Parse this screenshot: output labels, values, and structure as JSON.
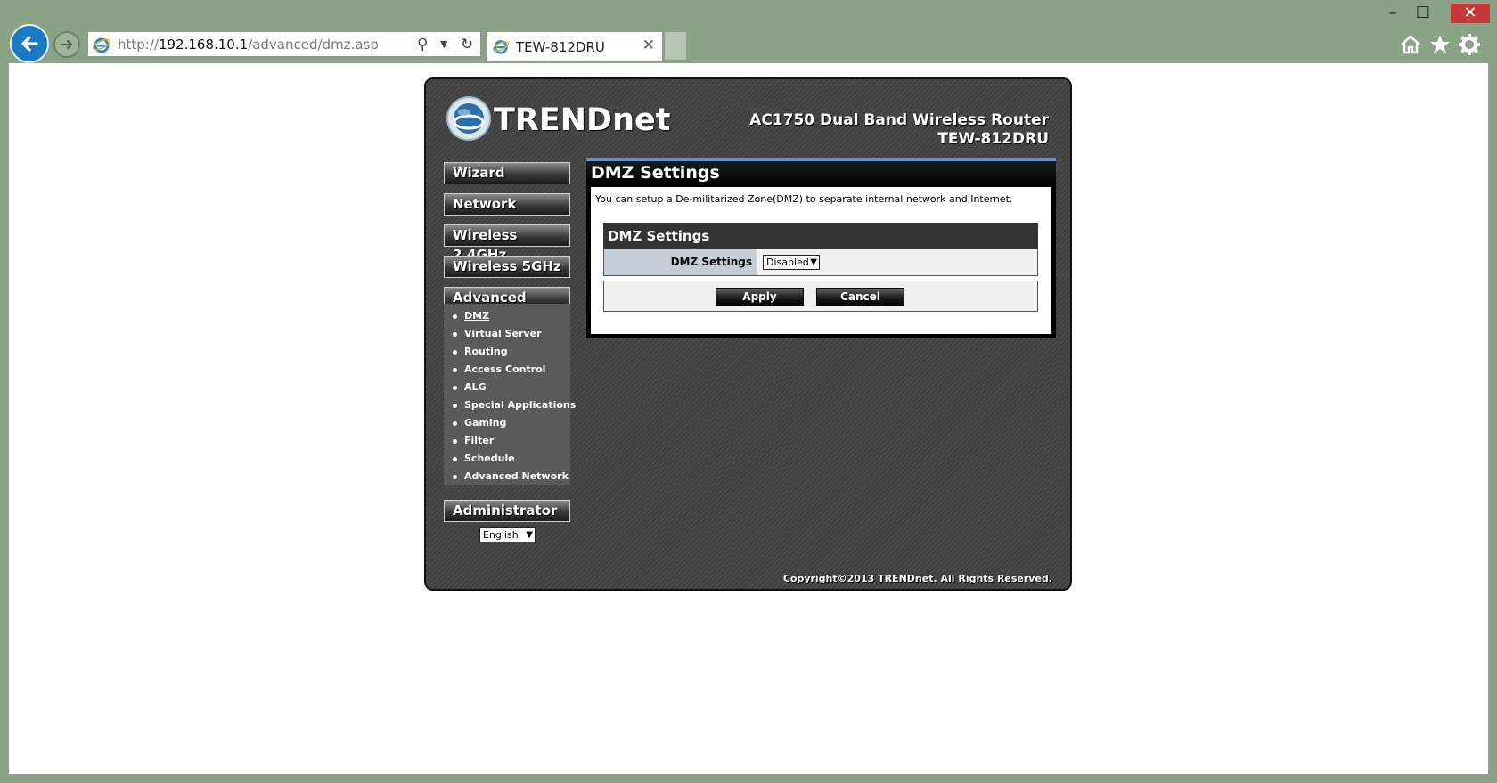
{
  "browser": {
    "url_prefix": "http://",
    "url_host": "192.168.10.1",
    "url_path": "/advanced/dmz.asp",
    "tab_title": "TEW-812DRU",
    "window_controls": {
      "minimize": "–",
      "maximize": "☐",
      "close": "✕"
    }
  },
  "router": {
    "brand": "TRENDnet",
    "model_line1": "AC1750 Dual Band Wireless Router",
    "model_line2": "TEW-812DRU",
    "menu": {
      "wizard": "Wizard",
      "network": "Network",
      "wireless24": "Wireless 2.4GHz",
      "wireless5": "Wireless 5GHz",
      "advanced": "Advanced",
      "administrator": "Administrator"
    },
    "submenu": [
      "DMZ",
      "Virtual Server",
      "Routing",
      "Access Control",
      "ALG",
      "Special Applications",
      "Gaming",
      "Filter",
      "Schedule",
      "Advanced Network"
    ],
    "language": "English",
    "copyright": "Copyright©2013 TRENDnet. All Rights Reserved."
  },
  "content": {
    "title": "DMZ Settings",
    "description": "You can setup a De-militarized Zone(DMZ) to separate internal network and Internet.",
    "section_title": "DMZ Settings",
    "field_label": "DMZ Settings",
    "field_value": "Disabled",
    "apply_label": "Apply",
    "cancel_label": "Cancel"
  }
}
